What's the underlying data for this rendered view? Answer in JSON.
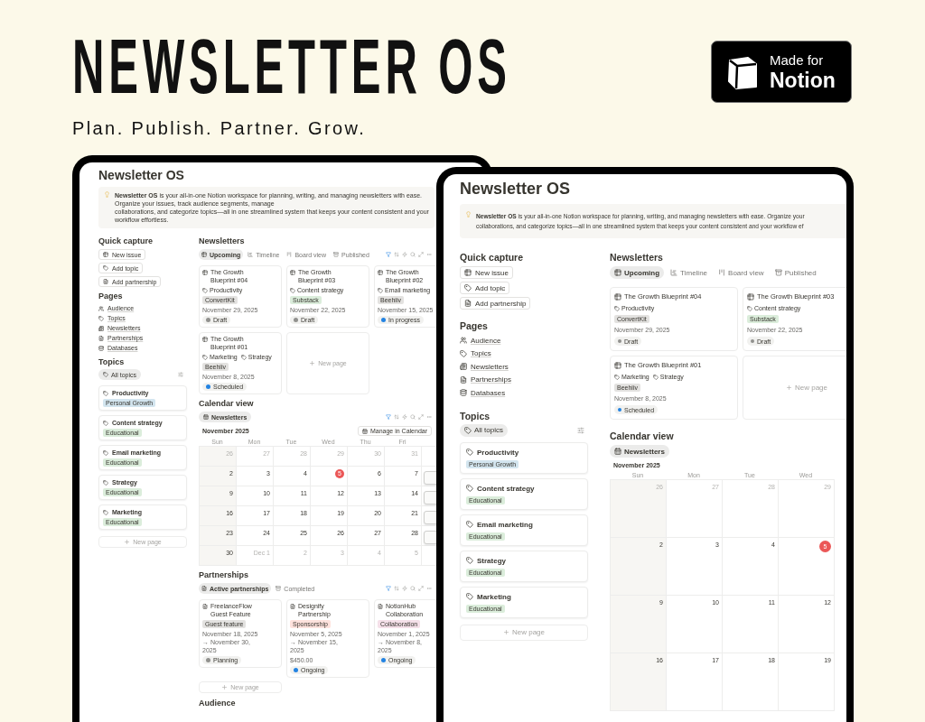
{
  "headline": "NEWSLETTER OS",
  "tagline": "Plan. Publish. Partner. Grow.",
  "badge": {
    "line1": "Made for",
    "line2": "Notion"
  },
  "screens": [
    {
      "title": "Newsletter OS",
      "callout": [
        "**Newsletter OS** is your all-in-one Notion workspace for planning, writing, and managing newsletters with ease. Organize your issues, track audience segments, manage",
        "collaborations, and categorize topics—all in one streamlined system that keeps your content consistent and your workflow effortless."
      ],
      "quick_capture": {
        "heading": "Quick capture",
        "buttons": [
          {
            "kind": "table",
            "label": "New issue"
          },
          {
            "kind": "tag",
            "label": "Add topic"
          },
          {
            "kind": "doc",
            "label": "Add partnership"
          }
        ]
      },
      "pages": {
        "heading": "Pages",
        "items": [
          {
            "kind": "people",
            "label": "Audience"
          },
          {
            "kind": "tag",
            "label": "Topics"
          },
          {
            "kind": "newspaper",
            "label": "Newsletters"
          },
          {
            "kind": "doc",
            "label": "Partnerships"
          },
          {
            "kind": "database",
            "label": "Databases"
          }
        ]
      },
      "topics": {
        "heading": "Topics",
        "filter": "All topics",
        "new_page": "New page",
        "cards": [
          {
            "name": "Productivity",
            "tag": "Personal Growth",
            "color": "#d3e5ef"
          },
          {
            "name": "Content strategy",
            "tag": "Educational",
            "color": "#dbeddb"
          },
          {
            "name": "Email marketing",
            "tag": "Educational",
            "color": "#dbeddb"
          },
          {
            "name": "Strategy",
            "tag": "Educational",
            "color": "#dbeddb"
          },
          {
            "name": "Marketing",
            "tag": "Educational",
            "color": "#dbeddb"
          }
        ]
      },
      "newsletters": {
        "heading": "Newsletters",
        "toolbar_icons": true,
        "new_page": "New page",
        "tabs": [
          {
            "kind": "table",
            "label": "Upcoming",
            "selected": true
          },
          {
            "kind": "timeline",
            "label": "Timeline",
            "selected": false
          },
          {
            "kind": "board",
            "label": "Board view",
            "selected": false
          },
          {
            "kind": "archive",
            "label": "Published",
            "selected": false
          }
        ],
        "cards": [
          {
            "title": "The Growth Blueprint #04",
            "topics": [
              "Productivity"
            ],
            "platform": {
              "label": "ConvertKit",
              "color": "#e3e2e0"
            },
            "date": "November 29, 2025",
            "status": {
              "label": "Draft",
              "color": "#91918e"
            }
          },
          {
            "title": "The Growth Blueprint #03",
            "topics": [
              "Content strategy"
            ],
            "platform": {
              "label": "Substack",
              "color": "#dbeddb"
            },
            "date": "November 22, 2025",
            "status": {
              "label": "Draft",
              "color": "#91918e"
            }
          },
          {
            "title": "The Growth Blueprint #02",
            "topics": [
              "Email marketing"
            ],
            "platform": {
              "label": "Beehiiv",
              "color": "#e3e2e0"
            },
            "date": "November 15, 2025",
            "status": {
              "label": "In progress",
              "color": "#2383e2"
            }
          },
          {
            "title": "The Growth Blueprint #01",
            "topics": [
              "Marketing",
              "Strategy"
            ],
            "platform": {
              "label": "Beehiiv",
              "color": "#e3e2e0"
            },
            "date": "November 8, 2025",
            "status": {
              "label": "Scheduled",
              "color": "#2383e2"
            }
          }
        ]
      },
      "calendar": {
        "heading": "Calendar view",
        "view": "Newsletters",
        "month": "November 2025",
        "manage": "Manage in Calendar",
        "toolbar_icons": true,
        "days": [
          "Sun",
          "Mon",
          "Tue",
          "Wed",
          "Thu",
          "Fri"
        ],
        "weeks": [
          [
            {
              "day": "26",
              "muted": true,
              "today": false
            },
            {
              "day": "27",
              "muted": true,
              "today": false
            },
            {
              "day": "28",
              "muted": true,
              "today": false
            },
            {
              "day": "29",
              "muted": true,
              "today": false
            },
            {
              "day": "30",
              "muted": true,
              "today": false
            },
            {
              "day": "31",
              "muted": true,
              "today": false
            },
            {
              "event": false
            }
          ],
          [
            {
              "day": "2",
              "muted": false,
              "today": false
            },
            {
              "day": "3",
              "muted": false,
              "today": false
            },
            {
              "day": "4",
              "muted": false,
              "today": false
            },
            {
              "day": "5",
              "muted": false,
              "today": true
            },
            {
              "day": "6",
              "muted": false,
              "today": false
            },
            {
              "day": "7",
              "muted": false,
              "today": false
            },
            {
              "event": true
            }
          ],
          [
            {
              "day": "9",
              "muted": false,
              "today": false
            },
            {
              "day": "10",
              "muted": false,
              "today": false
            },
            {
              "day": "11",
              "muted": false,
              "today": false
            },
            {
              "day": "12",
              "muted": false,
              "today": false
            },
            {
              "day": "13",
              "muted": false,
              "today": false
            },
            {
              "day": "14",
              "muted": false,
              "today": false
            },
            {
              "event": true
            }
          ],
          [
            {
              "day": "16",
              "muted": false,
              "today": false
            },
            {
              "day": "17",
              "muted": false,
              "today": false
            },
            {
              "day": "18",
              "muted": false,
              "today": false
            },
            {
              "day": "19",
              "muted": false,
              "today": false
            },
            {
              "day": "20",
              "muted": false,
              "today": false
            },
            {
              "day": "21",
              "muted": false,
              "today": false
            },
            {
              "event": true
            }
          ],
          [
            {
              "day": "23",
              "muted": false,
              "today": false
            },
            {
              "day": "24",
              "muted": false,
              "today": false
            },
            {
              "day": "25",
              "muted": false,
              "today": false
            },
            {
              "day": "26",
              "muted": false,
              "today": false
            },
            {
              "day": "27",
              "muted": false,
              "today": false
            },
            {
              "day": "28",
              "muted": false,
              "today": false
            },
            {
              "event": true
            }
          ],
          [
            {
              "day": "30",
              "muted": false,
              "today": false
            },
            {
              "day": "Dec 1",
              "muted": true,
              "today": false
            },
            {
              "day": "2",
              "muted": true,
              "today": false
            },
            {
              "day": "3",
              "muted": true,
              "today": false
            },
            {
              "day": "4",
              "muted": true,
              "today": false
            },
            {
              "day": "5",
              "muted": true,
              "today": false
            },
            {
              "event": false
            }
          ]
        ]
      },
      "partnerships": {
        "heading": "Partnerships",
        "toolbar_icons": true,
        "new_page": "New page",
        "tabs": [
          {
            "kind": "doc",
            "label": "Active partnerships",
            "selected": true
          },
          {
            "kind": "archive",
            "label": "Completed",
            "selected": false
          }
        ],
        "cards": [
          {
            "title": "FreelanceFlow Guest Feature",
            "tag": {
              "label": "Guest feature",
              "color": "#e3e2e0"
            },
            "dates": "November 18, 2025 → November 30, 2025",
            "status": {
              "label": "Planning",
              "color": "#91918e"
            }
          },
          {
            "title": "Designify Partnership",
            "tag": {
              "label": "Sponsorship",
              "color": "#ffe2dd"
            },
            "dates": "November 5, 2025 → November 15, 2025",
            "amount": "$450.00",
            "status": {
              "label": "Ongoing",
              "color": "#2383e2"
            }
          },
          {
            "title": "NotionHub Collaboration",
            "tag": {
              "label": "Collaboration",
              "color": "#f5e0e9"
            },
            "dates": "November 1, 2025 → November 8, 2025",
            "status": {
              "label": "Ongoing",
              "color": "#2383e2"
            }
          }
        ]
      },
      "audience": {
        "heading": "Audience"
      }
    },
    {
      "title": "Newsletter OS",
      "callout": [
        "**Newsletter OS** is your all-in-one Notion workspace for planning, writing, and managing newsletters with ease. Organize your",
        "collaborations, and categorize topics—all in one streamlined system that keeps your content consistent and your workflow ef"
      ],
      "quick_capture": {
        "heading": "Quick capture",
        "buttons": [
          {
            "kind": "table",
            "label": "New issue"
          },
          {
            "kind": "tag",
            "label": "Add topic"
          },
          {
            "kind": "doc",
            "label": "Add partnership"
          }
        ]
      },
      "pages": {
        "heading": "Pages",
        "items": [
          {
            "kind": "people",
            "label": "Audience"
          },
          {
            "kind": "tag",
            "label": "Topics"
          },
          {
            "kind": "newspaper",
            "label": "Newsletters"
          },
          {
            "kind": "doc",
            "label": "Partnerships"
          },
          {
            "kind": "database",
            "label": "Databases"
          }
        ]
      },
      "topics": {
        "heading": "Topics",
        "filter": "All topics",
        "new_page": "New page",
        "cards": [
          {
            "name": "Productivity",
            "tag": "Personal Growth",
            "color": "#d3e5ef"
          },
          {
            "name": "Content strategy",
            "tag": "Educational",
            "color": "#dbeddb"
          },
          {
            "name": "Email marketing",
            "tag": "Educational",
            "color": "#dbeddb"
          },
          {
            "name": "Strategy",
            "tag": "Educational",
            "color": "#dbeddb"
          },
          {
            "name": "Marketing",
            "tag": "Educational",
            "color": "#dbeddb"
          }
        ]
      },
      "newsletters": {
        "heading": "Newsletters",
        "toolbar_icons": false,
        "new_page": "New page",
        "tabs": [
          {
            "kind": "table",
            "label": "Upcoming",
            "selected": true
          },
          {
            "kind": "timeline",
            "label": "Timeline",
            "selected": false
          },
          {
            "kind": "board",
            "label": "Board view",
            "selected": false
          },
          {
            "kind": "archive",
            "label": "Published",
            "selected": false
          }
        ],
        "cards": [
          {
            "title": "The Growth Blueprint #04",
            "topics": [
              "Productivity"
            ],
            "platform": {
              "label": "ConvertKit",
              "color": "#e3e2e0"
            },
            "date": "November 29, 2025",
            "status": {
              "label": "Draft",
              "color": "#91918e"
            }
          },
          {
            "title": "The Growth Blueprint #03",
            "topics": [
              "Content strategy"
            ],
            "platform": {
              "label": "Substack",
              "color": "#dbeddb"
            },
            "date": "November 22, 2025",
            "status": {
              "label": "Draft",
              "color": "#91918e"
            }
          },
          {
            "title": "The Growth Blueprint #01",
            "topics": [
              "Marketing",
              "Strategy"
            ],
            "platform": {
              "label": "Beehiiv",
              "color": "#e3e2e0"
            },
            "date": "November 8, 2025",
            "status": {
              "label": "Scheduled",
              "color": "#2383e2"
            }
          }
        ]
      },
      "calendar": {
        "heading": "Calendar view",
        "view": "Newsletters",
        "month": "November 2025",
        "toolbar_icons": false,
        "days": [
          "Sun",
          "Mon",
          "Tue",
          "Wed"
        ],
        "weeks": [
          [
            {
              "day": "26",
              "muted": true,
              "today": false
            },
            {
              "day": "27",
              "muted": true,
              "today": false
            },
            {
              "day": "28",
              "muted": true,
              "today": false
            },
            {
              "day": "29",
              "muted": true,
              "today": false
            }
          ],
          [
            {
              "day": "2",
              "muted": false,
              "today": false
            },
            {
              "day": "3",
              "muted": false,
              "today": false
            },
            {
              "day": "4",
              "muted": false,
              "today": false
            },
            {
              "day": "5",
              "muted": false,
              "today": true
            }
          ],
          [
            {
              "day": "9",
              "muted": false,
              "today": false
            },
            {
              "day": "10",
              "muted": false,
              "today": false
            },
            {
              "day": "11",
              "muted": false,
              "today": false
            },
            {
              "day": "12",
              "muted": false,
              "today": false
            }
          ],
          [
            {
              "day": "16",
              "muted": false,
              "today": false
            },
            {
              "day": "17",
              "muted": false,
              "today": false
            },
            {
              "day": "18",
              "muted": false,
              "today": false
            },
            {
              "day": "19",
              "muted": false,
              "today": false
            }
          ]
        ]
      }
    }
  ]
}
